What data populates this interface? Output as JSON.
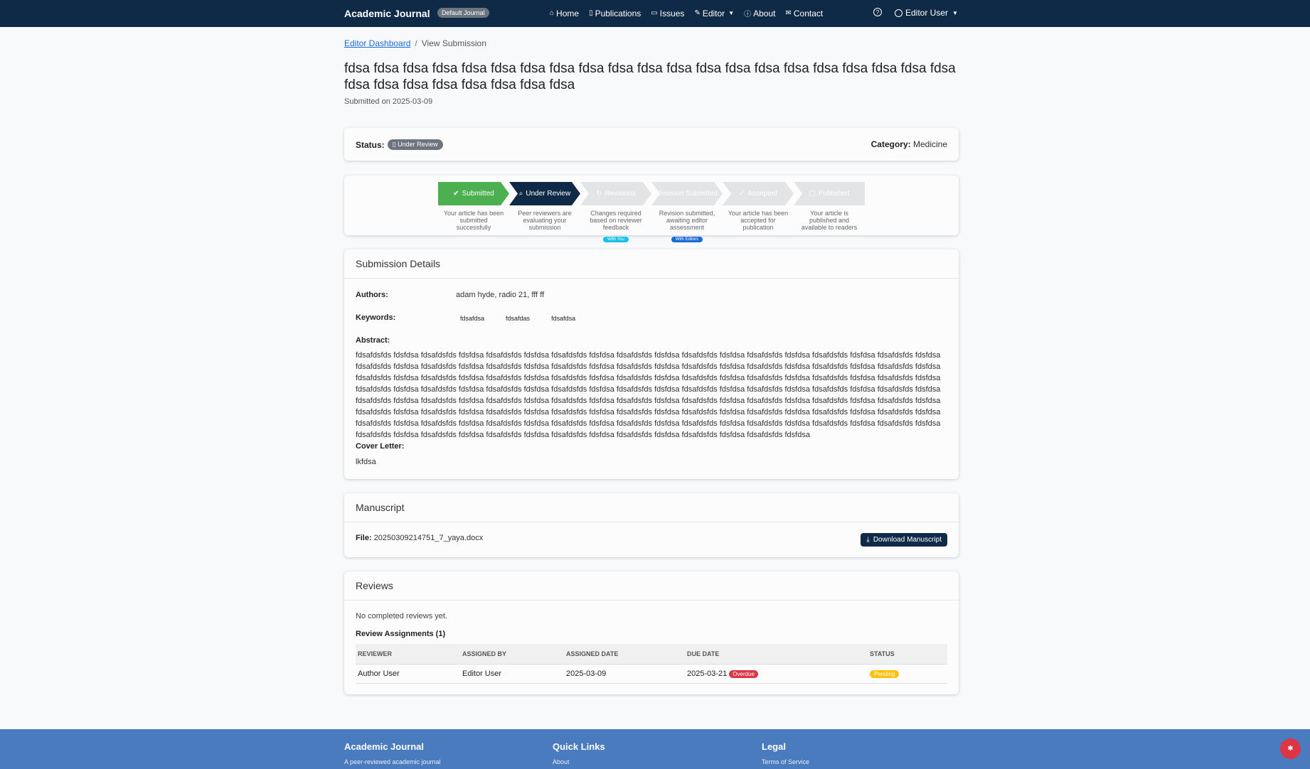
{
  "nav": {
    "brand": "Academic Journal",
    "badge": "Default Journal",
    "links": [
      "Home",
      "Publications",
      "Issues",
      "Editor",
      "About",
      "Contact"
    ],
    "user": "Editor User"
  },
  "breadcrumb": {
    "parent": "Editor Dashboard",
    "current": "View Submission"
  },
  "title": "fdsa fdsa fdsa fdsa fdsa fdsa fdsa fdsa fdsa fdsa fdsa fdsa fdsa fdsa fdsa fdsa fdsa fdsa fdsa fdsa fdsa fdsa fdsa fdsa fdsa fdsa fdsa fdsa fdsa",
  "submitted_on": "Submitted on 2025-03-09",
  "status": {
    "label": "Status:",
    "value": "Under Review",
    "category_label": "Category:",
    "category": "Medicine"
  },
  "steps": [
    {
      "name": "Submitted",
      "desc": "Your article has been submitted successfully",
      "state": "done",
      "badge": ""
    },
    {
      "name": "Under Review",
      "desc": "Peer reviewers are evaluating your submission",
      "state": "active",
      "badge": ""
    },
    {
      "name": "Revisions",
      "desc": "Changes required based on reviewer feedback",
      "state": "pending",
      "badge": "With You"
    },
    {
      "name": "Revision Submitted",
      "desc": "Revision submitted, awaiting editor assessment",
      "state": "pending",
      "badge": "With Editors"
    },
    {
      "name": "Accepted",
      "desc": "Your article has been accepted for publication",
      "state": "pending",
      "badge": ""
    },
    {
      "name": "Published",
      "desc": "Your article is published and available to readers",
      "state": "pending",
      "badge": ""
    }
  ],
  "details": {
    "header": "Submission Details",
    "authors_label": "Authors:",
    "authors": "adam hyde, radio 21, fff ff",
    "keywords_label": "Keywords:",
    "keywords": [
      "fdsafdsa",
      "fdsafdas",
      "fdsafdsa"
    ],
    "abstract_label": "Abstract:",
    "abstract": "fdsafdsfds fdsfdsa fdsafdsfds fdsfdsa fdsafdsfds fdsfdsa fdsafdsfds fdsfdsa fdsafdsfds fdsfdsa fdsafdsfds fdsfdsa fdsafdsfds fdsfdsa fdsafdsfds fdsfdsa fdsafdsfds fdsfdsa fdsafdsfds fdsfdsa fdsafdsfds fdsfdsa fdsafdsfds fdsfdsa fdsafdsfds fdsfdsa fdsafdsfds fdsfdsa fdsafdsfds fdsfdsa fdsafdsfds fdsfdsa fdsafdsfds fdsfdsa fdsafdsfds fdsfdsa fdsafdsfds fdsfdsa fdsafdsfds fdsfdsa fdsafdsfds fdsfdsa fdsafdsfds fdsfdsa fdsafdsfds fdsfdsa fdsafdsfds fdsfdsa fdsafdsfds fdsfdsa fdsafdsfds fdsfdsa fdsafdsfds fdsfdsa fdsafdsfds fdsfdsa fdsafdsfds fdsfdsa fdsafdsfds fdsfdsa fdsafdsfds fdsfdsa fdsafdsfds fdsfdsa fdsafdsfds fdsfdsa fdsafdsfds fdsfdsa fdsafdsfds fdsfdsa fdsafdsfds fdsfdsa fdsafdsfds fdsfdsa fdsafdsfds fdsfdsa fdsafdsfds fdsfdsa fdsafdsfds fdsfdsa fdsafdsfds fdsfdsa fdsafdsfds fdsfdsa fdsafdsfds fdsfdsa fdsafdsfds fdsfdsa fdsafdsfds fdsfdsa fdsafdsfds fdsfdsa fdsafdsfds fdsfdsa fdsafdsfds fdsfdsa fdsafdsfds fdsfdsa fdsafdsfds fdsfdsa fdsafdsfds fdsfdsa fdsafdsfds fdsfdsa fdsafdsfds fdsfdsa fdsafdsfds fdsfdsa fdsafdsfds fdsfdsa fdsafdsfds fdsfdsa fdsafdsfds fdsfdsa fdsafdsfds fdsfdsa fdsafdsfds fdsfdsa fdsafdsfds fdsfdsa fdsafdsfds fdsfdsa fdsafdsfds fdsfdsa fdsafdsfds fdsfdsa fdsafdsfds fdsfdsa fdsafdsfds fdsfdsa fdsafdsfds fdsfdsa fdsafdsfds fdsfdsa fdsafdsfds fdsfdsa fdsafdsfds fdsfdsa fdsafdsfds fdsfdsa",
    "cover_label": "Cover Letter:",
    "cover": "lkfdsa"
  },
  "manuscript": {
    "header": "Manuscript",
    "file_label": "File:",
    "file": "20250309214751_7_yaya.docx",
    "download": "Download Manuscript"
  },
  "reviews": {
    "header": "Reviews",
    "none": "No completed reviews yet.",
    "assign_title": "Review Assignments (1)",
    "columns": [
      "REVIEWER",
      "ASSIGNED BY",
      "ASSIGNED DATE",
      "DUE DATE",
      "STATUS"
    ],
    "rows": [
      {
        "reviewer": "Author User",
        "assigned_by": "Editor User",
        "assigned_date": "2025-03-09",
        "due_date": "2025-03-21",
        "due_badge": "Overdue",
        "status": "Pending"
      }
    ]
  },
  "footer": {
    "col1_title": "Academic Journal",
    "col1_text": "A peer-reviewed academic journal",
    "col2_title": "Quick Links",
    "col2_text": "About",
    "col3_title": "Legal",
    "col3_text": "Terms of Service"
  },
  "colors": {
    "navbar": "#0f2a47",
    "done": "#4caf50",
    "footer": "#4a7bbf",
    "overdue": "#dc3545",
    "pending": "#ffc107",
    "link": "#1a6bd6"
  }
}
